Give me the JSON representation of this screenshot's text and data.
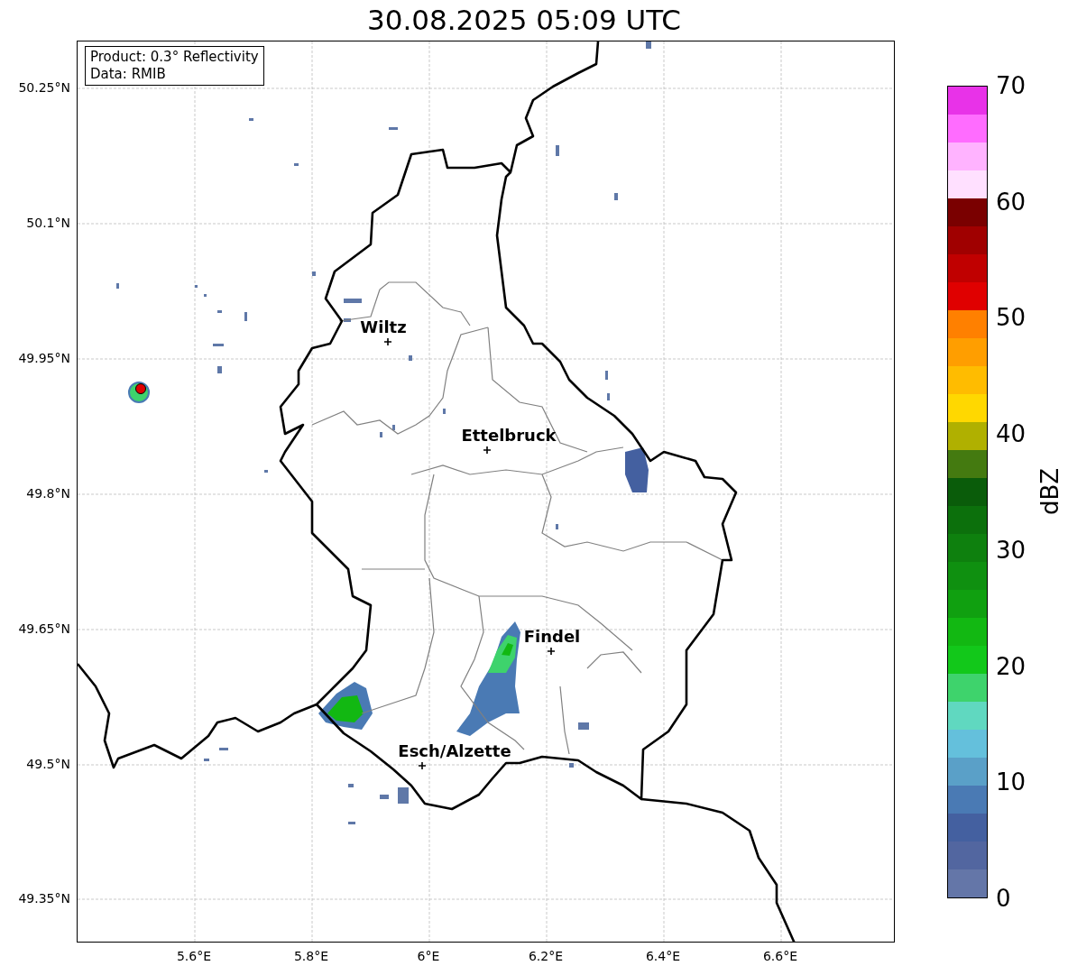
{
  "title": "30.08.2025 05:09 UTC",
  "map": {
    "info_box": [
      "Product: 0.3° Reflectivity",
      "Data: RMIB"
    ],
    "grid": true,
    "longitude_labels": [
      "5.6°E",
      "5.8°E",
      "6°E",
      "6.2°E",
      "6.4°E",
      "6.6°E"
    ],
    "latitude_labels": [
      "50.25°N",
      "50.1°N",
      "49.95°N",
      "49.8°N",
      "49.65°N",
      "49.5°N",
      "49.35°N"
    ],
    "cities": [
      "Wiltz",
      "Ettelbruck",
      "Findel",
      "Esch/Alzette"
    ]
  },
  "colorbar": {
    "label": "dBZ",
    "ticks": [
      "70",
      "60",
      "50",
      "40",
      "30",
      "20",
      "10",
      "0"
    ],
    "segments": [
      {
        "color": "#6476a8"
      },
      {
        "color": "#5266a0"
      },
      {
        "color": "#4460a0"
      },
      {
        "color": "#4a7ab4"
      },
      {
        "color": "#5aa0c8"
      },
      {
        "color": "#64c0dc"
      },
      {
        "color": "#60d8c0"
      },
      {
        "color": "#3ed36c"
      },
      {
        "color": "#12c81a"
      },
      {
        "color": "#12b812"
      },
      {
        "color": "#10a010"
      },
      {
        "color": "#0f9010"
      },
      {
        "color": "#0e800e"
      },
      {
        "color": "#0c700c"
      },
      {
        "color": "#0a5c0a"
      },
      {
        "color": "#447a10"
      },
      {
        "color": "#b0b000"
      },
      {
        "color": "#ffd800"
      },
      {
        "color": "#ffbc00"
      },
      {
        "color": "#ff9e00"
      },
      {
        "color": "#ff8000"
      },
      {
        "color": "#e00000"
      },
      {
        "color": "#c00000"
      },
      {
        "color": "#a00000"
      },
      {
        "color": "#7a0000"
      },
      {
        "color": "#ffe0ff"
      },
      {
        "color": "#ffb3ff"
      },
      {
        "color": "#ff6cff"
      },
      {
        "color": "#e832e8"
      }
    ]
  }
}
